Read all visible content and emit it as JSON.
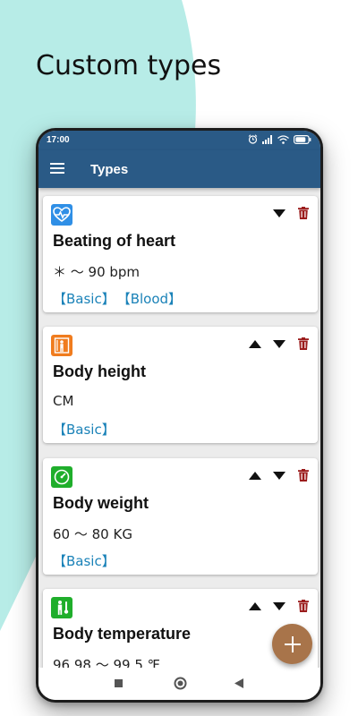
{
  "headline": "Custom types",
  "colors": {
    "background_accent": "#b7ece7",
    "appbar": "#2a5a86",
    "fab": "#a8744a",
    "tag_text": "#1a82b8",
    "delete_icon": "#9b1c1c"
  },
  "status_bar": {
    "time": "17:00",
    "icons": [
      "alarm-icon",
      "signal-icon",
      "wifi-icon",
      "battery-icon"
    ]
  },
  "app_bar": {
    "title": "Types",
    "menu_icon": "hamburger-menu-icon"
  },
  "cards": [
    {
      "name": "Beating of heart",
      "range": "＊ 〜 90 bpm",
      "tags": [
        "【Basic】",
        "【Blood】"
      ],
      "icon": "heartbeat-icon",
      "icon_color": "#2f8fe6",
      "show_up": false,
      "show_down": true
    },
    {
      "name": "Body height",
      "range": "CM",
      "tags": [
        "【Basic】"
      ],
      "icon": "height-icon",
      "icon_color": "#f07c1e",
      "show_up": true,
      "show_down": true
    },
    {
      "name": "Body weight",
      "range": "60 〜 80 KG",
      "tags": [
        "【Basic】"
      ],
      "icon": "scale-icon",
      "icon_color": "#1fae2b",
      "show_up": true,
      "show_down": true
    },
    {
      "name": "Body temperature",
      "range": "96.98 〜 99.5 ℉",
      "tags": [],
      "icon": "thermometer-person-icon",
      "icon_color": "#1fae2b",
      "show_up": true,
      "show_down": true
    }
  ],
  "fab": {
    "icon": "plus-icon"
  },
  "nav_bar": {
    "icons": [
      "recents-square-icon",
      "home-circle-icon",
      "back-triangle-icon"
    ]
  }
}
